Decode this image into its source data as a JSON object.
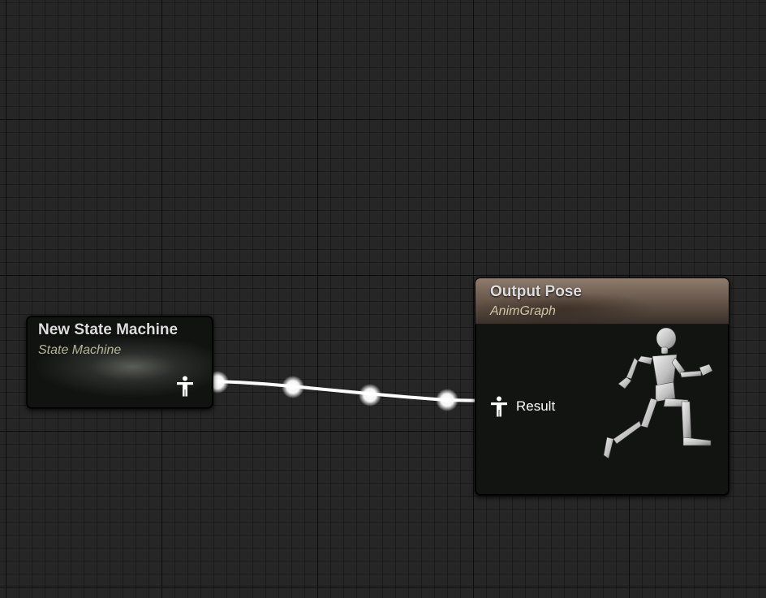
{
  "graph": {
    "name": "AnimGraph canvas"
  },
  "nodes": {
    "state_machine": {
      "title": "New State Machine",
      "subtitle": "State Machine",
      "output_pin_icon": "pose-pin-icon"
    },
    "output_pose": {
      "title": "Output Pose",
      "subtitle": "AnimGraph",
      "input_pin_label": "Result",
      "input_pin_icon": "pose-pin-icon",
      "preview_icon": "running-mannequin-icon"
    }
  },
  "connection": {
    "from": "New State Machine",
    "to": "Result",
    "color": "#ffffff"
  },
  "colors": {
    "background": "#262626",
    "output_header": "#8e7c6d",
    "subtitle": "#b8b49a"
  }
}
